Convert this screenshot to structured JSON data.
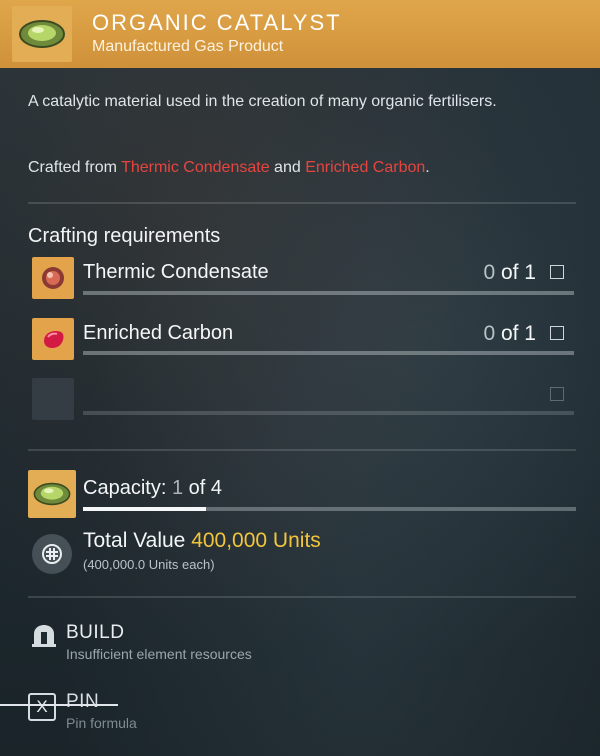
{
  "header": {
    "title": "ORGANIC CATALYST",
    "subtitle": "Manufactured Gas Product",
    "icon": "green-orb-icon",
    "accent": "#e0a64a"
  },
  "description": "A catalytic material used in the creation of many organic fertilisers.",
  "crafted": {
    "prefix": "Crafted from ",
    "ingredient_1": "Thermic Condensate",
    "joiner": " and ",
    "ingredient_2": "Enriched Carbon",
    "suffix": ".",
    "ingredient_color": "#e8443f"
  },
  "requirements": {
    "title": "Crafting requirements",
    "items": [
      {
        "name": "Thermic Condensate",
        "have": "0",
        "of": " of 1",
        "icon": "thermic-condensate-icon",
        "checked": false
      },
      {
        "name": "Enriched Carbon",
        "have": "0",
        "of": " of 1",
        "icon": "enriched-carbon-icon",
        "checked": false
      },
      {
        "name": "",
        "have": "",
        "of": "",
        "icon": "empty-slot-icon",
        "checked": false
      }
    ]
  },
  "capacity": {
    "label": "Capacity: ",
    "current": "1",
    "rest": " of 4",
    "fill_fraction": 0.25
  },
  "value": {
    "label": "Total Value ",
    "amount": "400,000 Units",
    "each": "(400,000.0 Units each)",
    "amount_color": "#f2c53d"
  },
  "actions": {
    "build_label": "BUILD",
    "build_sub": "Insufficient element resources",
    "pin_key": "X",
    "pin_label": "PIN",
    "pin_sub": "Pin formula"
  }
}
